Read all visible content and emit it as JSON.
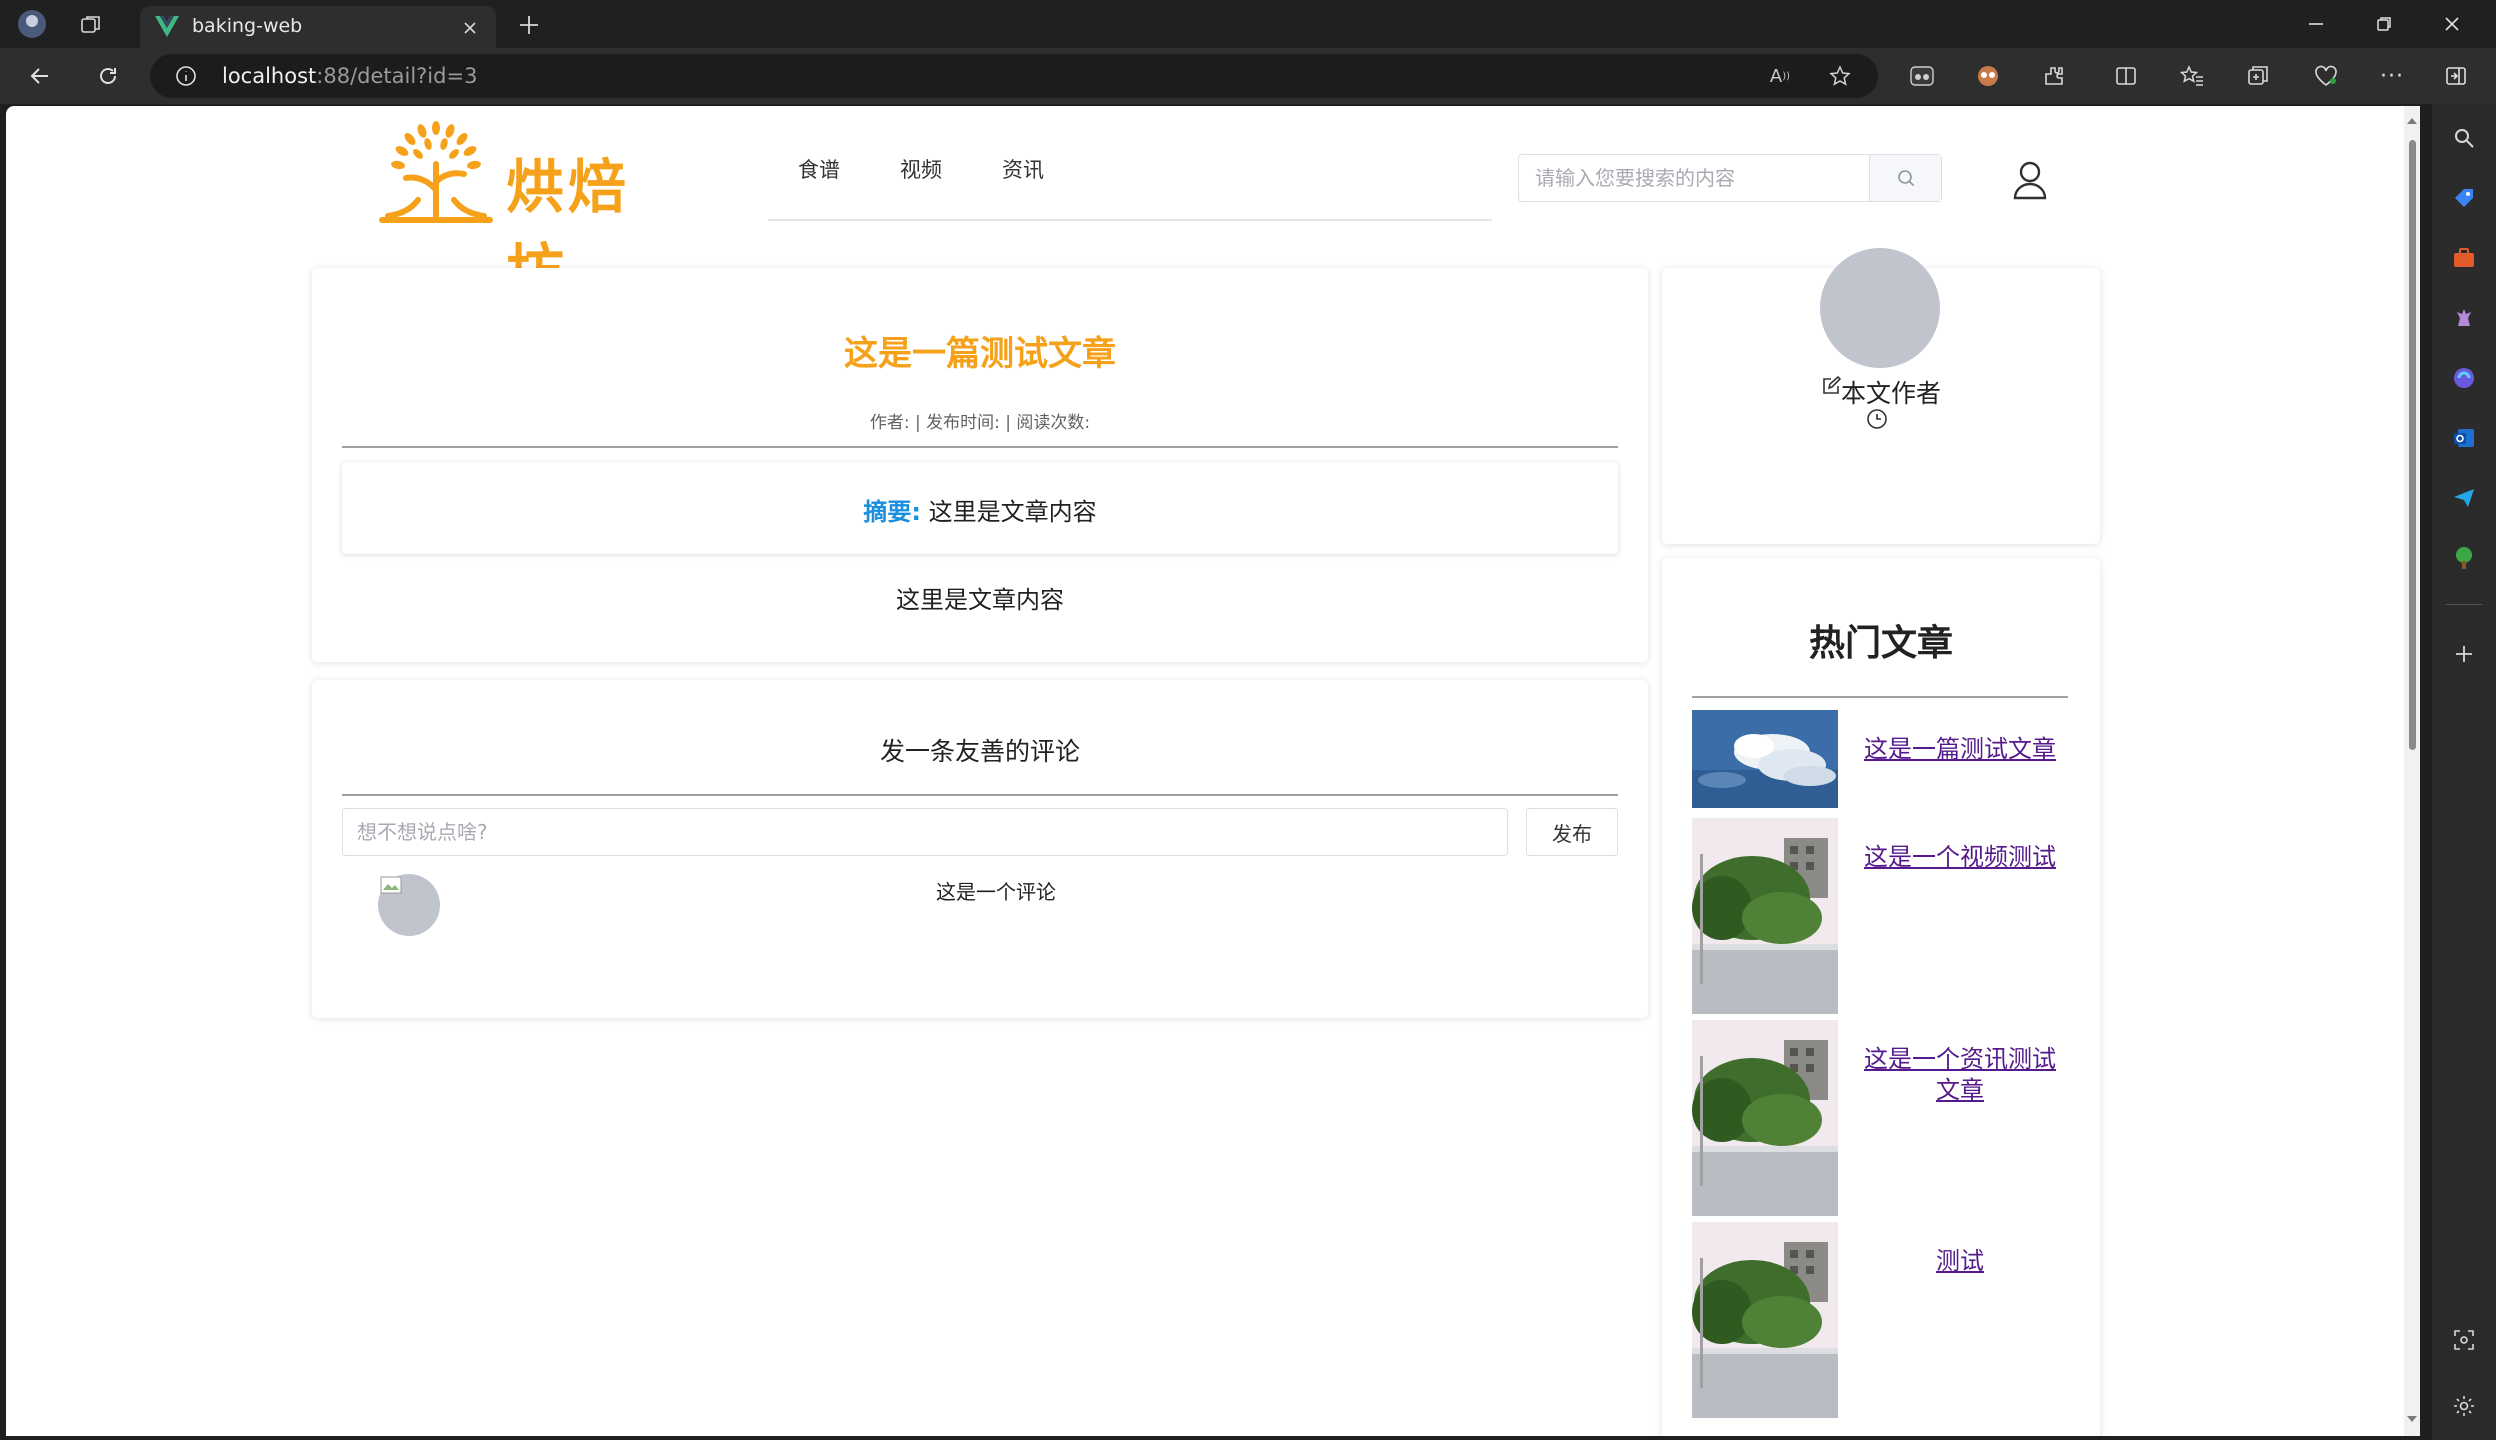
{
  "browser": {
    "tab_title": "baking-web",
    "url_host": "localhost",
    "url_rest": ":88/detail?id=3"
  },
  "header": {
    "logo_text": "烘焙坊",
    "nav": [
      "食谱",
      "视频",
      "资讯"
    ],
    "search_placeholder": "请输入您要搜索的内容"
  },
  "article": {
    "title": "这是一篇测试文章",
    "meta": "作者: | 发布时间: | 阅读次数:",
    "summary_label": "摘要:",
    "summary_text": " 这里是文章内容",
    "body": "这里是文章内容"
  },
  "comments": {
    "heading": "发一条友善的评论",
    "input_placeholder": "想不想说点啥?",
    "post_label": "发布",
    "items": [
      {
        "text": "这是一个评论"
      }
    ]
  },
  "author": {
    "label": "本文作者"
  },
  "hot": {
    "title": "热门文章",
    "items": [
      {
        "title": "这是一篇测试文章",
        "thumb": "sky-clouds"
      },
      {
        "title": "这是一个视频测试",
        "thumb": "building-trees"
      },
      {
        "title": "这是一个资讯测试文章",
        "thumb": "building-trees"
      },
      {
        "title": "测试",
        "thumb": "building-trees"
      }
    ]
  },
  "colors": {
    "brand_orange": "#f5a11a",
    "summary_blue": "#1a8fe0",
    "link_purple": "#551a8b"
  }
}
